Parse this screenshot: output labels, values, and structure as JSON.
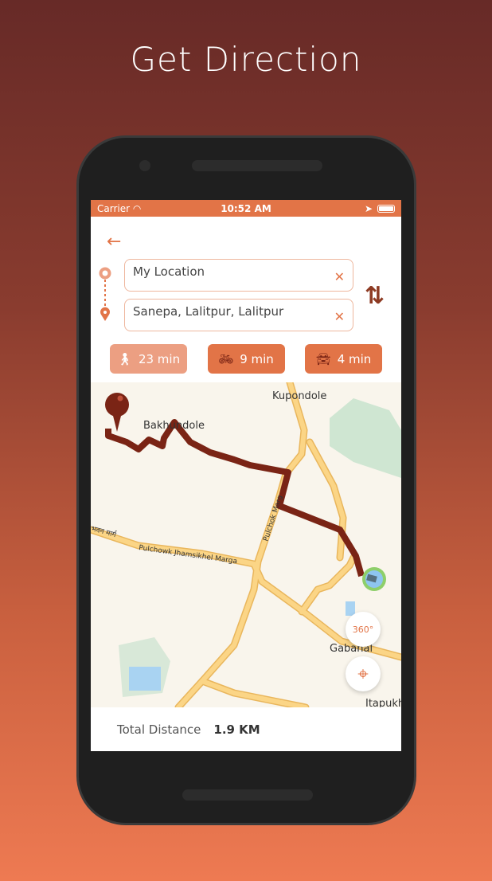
{
  "headline": "Get Direction",
  "status_bar": {
    "carrier": "Carrier",
    "time": "10:52 AM"
  },
  "origin": {
    "value": "My Location"
  },
  "destination": {
    "value": "Sanepa, Lalitpur, Lalitpur"
  },
  "modes": [
    {
      "icon": "walk-icon",
      "label": "23 min",
      "active": true
    },
    {
      "icon": "bicycle-icon",
      "label": "9 min",
      "active": false
    },
    {
      "icon": "car-icon",
      "label": "4 min",
      "active": false
    }
  ],
  "map": {
    "labels": [
      "Kupondole",
      "Bakhundole",
      "Pulchowk Jhamsikhel Marga",
      "Pulchok Marg",
      "Gabahal",
      "Itapukhu",
      "भवन मार्ग"
    ],
    "view_360_label": "360°"
  },
  "summary": {
    "label": "Total Distance",
    "value": "1.9 KM"
  },
  "colors": {
    "accent": "#e27447",
    "route": "#7a2415",
    "active_mode": "#ec9f82"
  }
}
